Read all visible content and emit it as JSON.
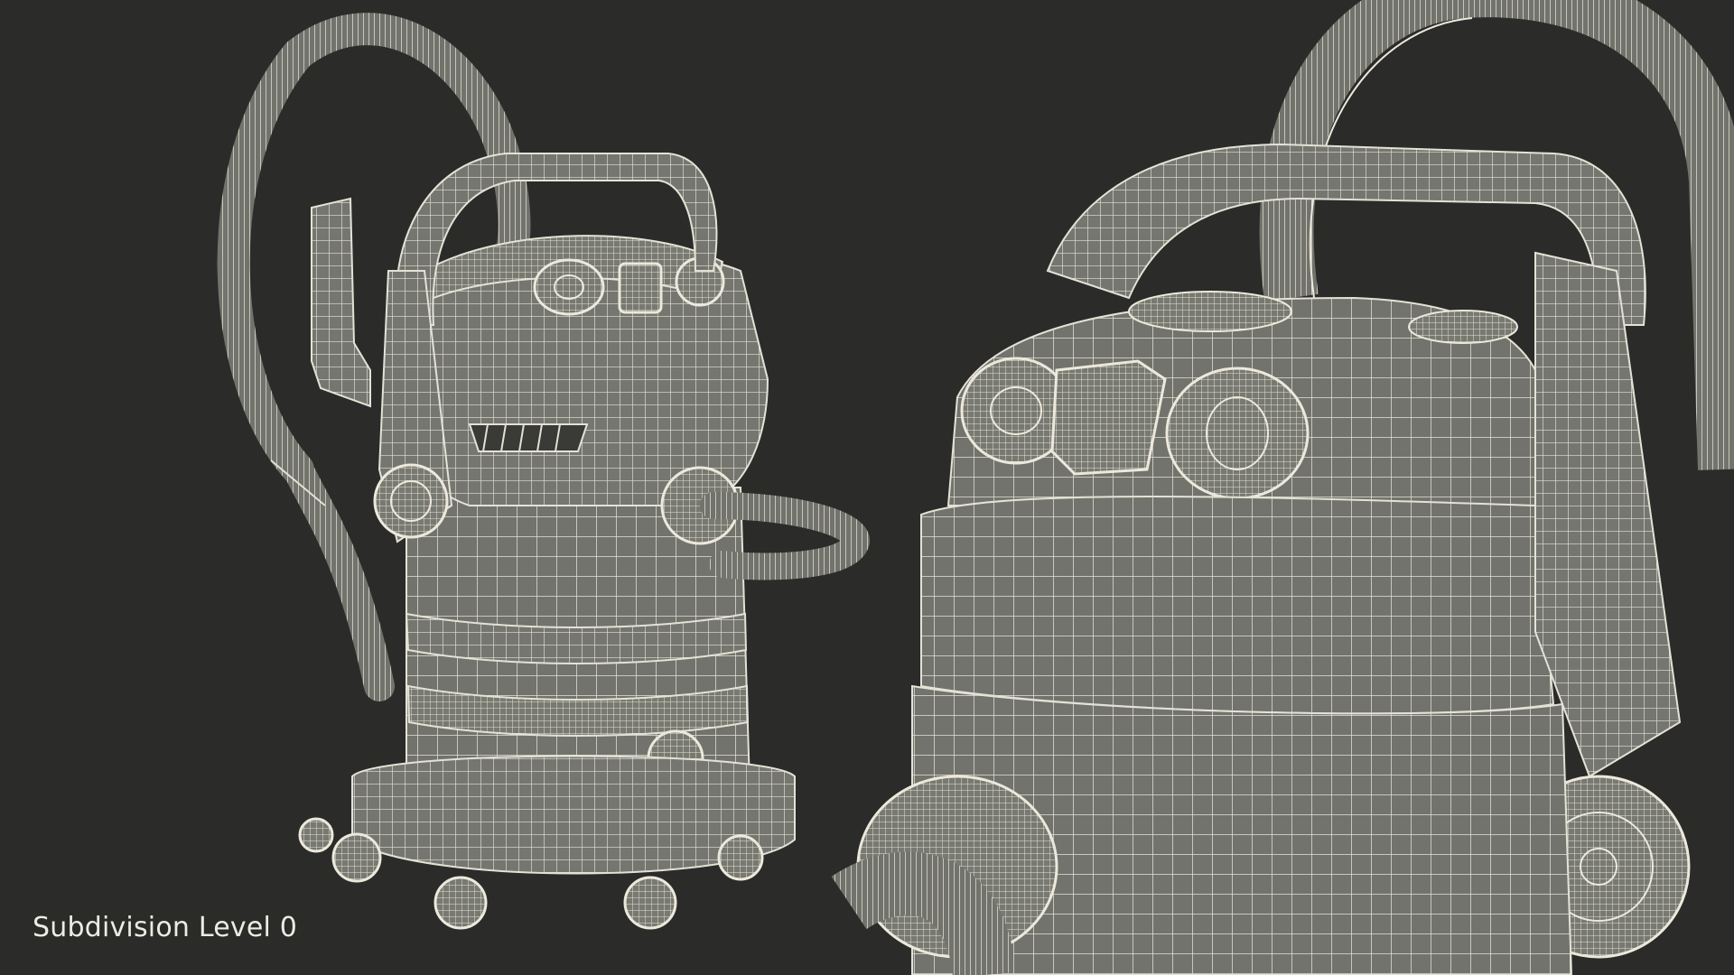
{
  "caption": "Subdivision Level 0",
  "colors": {
    "background": "#2b2b29",
    "mesh_surface": "#75766f",
    "wire": "#e6e4d8"
  },
  "objects": [
    {
      "name": "vacuum-left-view"
    },
    {
      "name": "vacuum-right-closeup"
    }
  ]
}
